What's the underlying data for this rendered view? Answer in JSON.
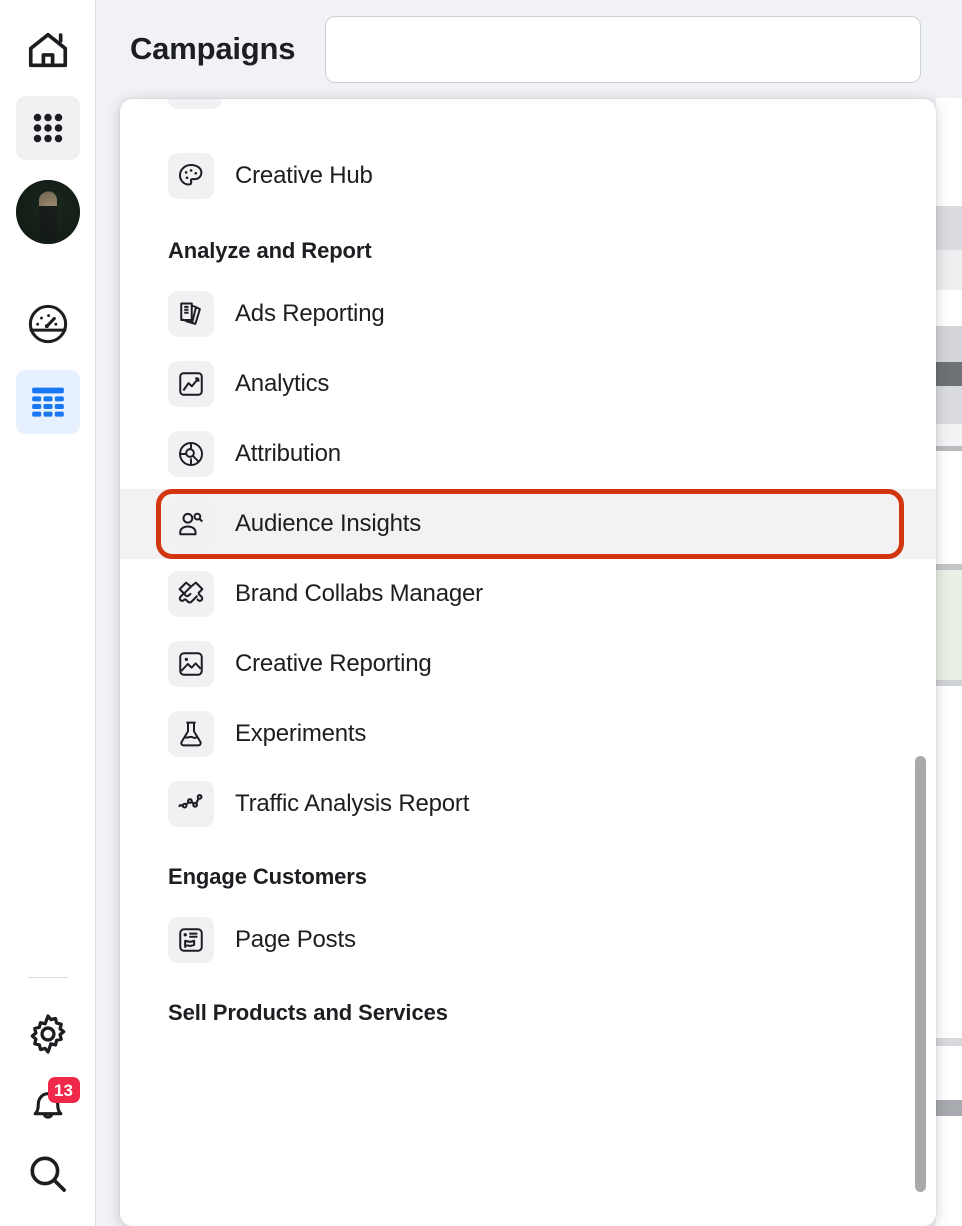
{
  "header": {
    "title": "Campaigns",
    "search": {
      "value": "",
      "placeholder": ""
    }
  },
  "rail": {
    "items": [
      {
        "name": "home",
        "icon": "home-icon",
        "state": "default"
      },
      {
        "name": "all-tools",
        "icon": "grid-apps-icon",
        "state": "active-grey"
      },
      {
        "name": "profile",
        "icon": "avatar",
        "state": "default"
      },
      {
        "name": "dashboard",
        "icon": "speedometer-icon",
        "state": "default"
      },
      {
        "name": "table-view",
        "icon": "table-icon",
        "state": "active-blue"
      }
    ],
    "bottom": [
      {
        "name": "settings",
        "icon": "gear-icon"
      },
      {
        "name": "notifications",
        "icon": "bell-icon",
        "badge": "13"
      },
      {
        "name": "search",
        "icon": "magnifier-icon"
      }
    ]
  },
  "panel": {
    "menu": [
      {
        "type": "item",
        "icon": "palette-icon",
        "label": "Creative Hub",
        "highlighted": false
      },
      {
        "type": "section",
        "label": "Analyze and Report"
      },
      {
        "type": "item",
        "icon": "documents-icon",
        "label": "Ads Reporting",
        "highlighted": false
      },
      {
        "type": "item",
        "icon": "chart-line-box-icon",
        "label": "Analytics",
        "highlighted": false
      },
      {
        "type": "item",
        "icon": "donut-magnifier-icon",
        "label": "Attribution",
        "highlighted": false
      },
      {
        "type": "item",
        "icon": "people-search-icon",
        "label": "Audience Insights",
        "highlighted": true
      },
      {
        "type": "item",
        "icon": "handshake-icon",
        "label": "Brand Collabs Manager",
        "highlighted": false
      },
      {
        "type": "item",
        "icon": "image-icon",
        "label": "Creative Reporting",
        "highlighted": false
      },
      {
        "type": "item",
        "icon": "flask-icon",
        "label": "Experiments",
        "highlighted": false
      },
      {
        "type": "item",
        "icon": "node-graph-icon",
        "label": "Traffic Analysis Report",
        "highlighted": false
      },
      {
        "type": "section",
        "label": "Engage Customers"
      },
      {
        "type": "item",
        "icon": "page-post-icon",
        "label": "Page Posts",
        "highlighted": false
      },
      {
        "type": "section",
        "label": "Sell Products and Services"
      }
    ],
    "scrollbar": {
      "visible": true
    }
  },
  "colors": {
    "highlight_ring": "#d2360f",
    "accent_blue": "#1877f2",
    "accent_blue_bg": "#e7f0fd",
    "badge_red": "#f02849",
    "page_bg": "#f0f2f5",
    "icon_bg": "#f0f1f2",
    "text": "#1c1e21"
  }
}
